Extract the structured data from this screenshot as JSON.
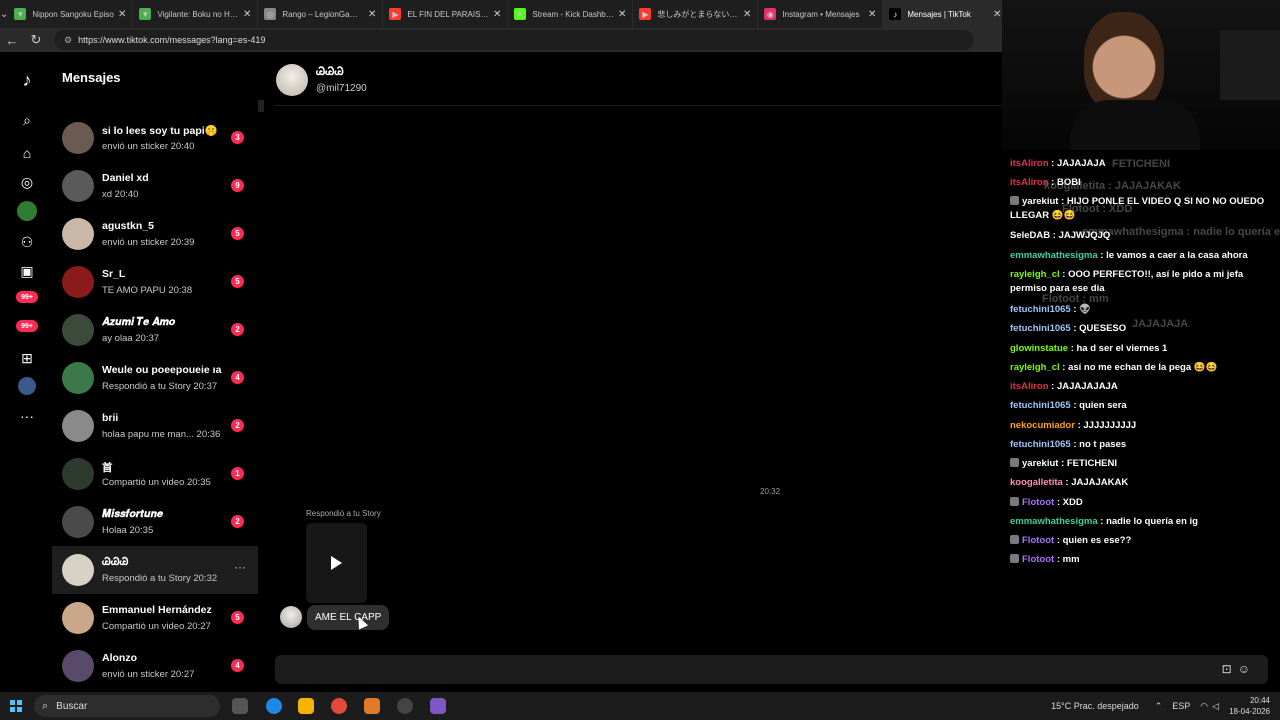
{
  "browser": {
    "tabs": [
      {
        "title": "Nippon Sangoku Episo",
        "color": "#4caf50",
        "glyph": "▼"
      },
      {
        "title": "Vigilante: Boku no Hero",
        "color": "#4caf50",
        "glyph": "▼"
      },
      {
        "title": "Rango – LegionGamesC",
        "color": "#888888",
        "glyph": "◎"
      },
      {
        "title": "EL FIN DEL PARAISO - r",
        "color": "#ff3b30",
        "glyph": "▶"
      },
      {
        "title": "Stream - Kick Dashboar",
        "color": "#53fc18",
        "glyph": "K"
      },
      {
        "title": "悲しみがとまらない | CA",
        "color": "#ff3b30",
        "glyph": "▶"
      },
      {
        "title": "Instagram • Mensajes",
        "color": "#e1306c",
        "glyph": "◉"
      },
      {
        "title": "Mensajes | TikTok",
        "color": "#000000",
        "glyph": "♪"
      }
    ],
    "url": "https://www.tiktok.com/messages?lang=es-419"
  },
  "sidebar": {
    "title": "Mensajes",
    "conversations": [
      {
        "name": "si lo lees soy tu papi🤫",
        "preview": "envió un sticker 20:40",
        "badge": "3",
        "avatar": "#6b5a52"
      },
      {
        "name": "Daniel xd",
        "preview": "xd 20:40",
        "badge": "9",
        "avatar": "#5a5a5a"
      },
      {
        "name": "agustkn_5",
        "preview": "envió un sticker 20:39",
        "badge": "5",
        "avatar": "#c9b8a8"
      },
      {
        "name": "Sr_L",
        "preview": "TE AMO PAPU 20:38",
        "badge": "5",
        "avatar": "#8b1a1a"
      },
      {
        "name": "𝑨𝒛𝒖𝒎𝒊 𝑻𝒆 𝑨𝒎𝒐",
        "preview": "ay olaa 20:37",
        "badge": "2",
        "avatar": "#3b4a3a"
      },
      {
        "name": "Weule ou poeepoueie ıa",
        "preview": "Respondió a tu Story 20:37",
        "badge": "4",
        "avatar": "#3a7a4a"
      },
      {
        "name": "brii",
        "preview": "holaa papu me man... 20:36",
        "badge": "2",
        "avatar": "#8a8a8a"
      },
      {
        "name": "首",
        "preview": "Compartió un video 20:35",
        "badge": "1",
        "avatar": "#2f3a2f"
      },
      {
        "name": "𝑴𝒊𝒔𝒔𝒇𝒐𝒓𝒕𝒖𝒏𝒆",
        "preview": "Holaa 20:35",
        "badge": "2",
        "avatar": "#4a4a4a"
      },
      {
        "name": "ᏊᏊᏊ",
        "preview": "Respondió a tu Story 20:32",
        "badge": "",
        "avatar": "#d8d2c6",
        "selected": true
      },
      {
        "name": "Emmanuel Hernández",
        "preview": "Compartió un video 20:27",
        "badge": "5",
        "avatar": "#c8a888"
      },
      {
        "name": "Alonzo",
        "preview": "envió un sticker 20:27",
        "badge": "4",
        "avatar": "#5a4a6a"
      }
    ]
  },
  "rail": {
    "badges": [
      "99+",
      "99+"
    ]
  },
  "chat": {
    "name": "ᏊᏊᏊ",
    "handle": "@mil71290",
    "timestamp": "20:32",
    "story_label": "Respondió a tu Story",
    "message": "AME EL CAPP"
  },
  "stream_chat": {
    "ghosts": [
      {
        "text": "FETICHENI"
      },
      {
        "text": "koogalletita : JAJAJAKAK"
      },
      {
        "text": "Flotoot : XDD"
      },
      {
        "text": "emmawhathesigma : nadie lo quería en"
      },
      {
        "text": "Flotoot : mm"
      },
      {
        "text": "JAJAJAJA"
      }
    ],
    "lines": [
      {
        "user": "itsAliron",
        "color": "#e0314b",
        "text": " : JAJAJAJA",
        "badge": false
      },
      {
        "user": "itsAliron",
        "color": "#e0314b",
        "text": " : BOBI",
        "badge": false
      },
      {
        "user": "yarekiut",
        "color": "#ffffff",
        "text": " : HIJO PONLE EL VIDEO Q SI NO NO OUEDO LLEGAR 😆😆",
        "badge": true
      },
      {
        "user": "SeleDAB",
        "color": "#ffffff",
        "text": " : JAJWJQJQ",
        "badge": false
      },
      {
        "user": "emmawhathesigma",
        "color": "#3fd09b",
        "text": " : le vamos a caer a la casa ahora",
        "badge": false
      },
      {
        "user": "rayleigh_cl",
        "color": "#7cfc00",
        "text": " : OOO PERFECTO!!, así le pido a mi jefa permiso para ese dia",
        "badge": false
      },
      {
        "user": "fetuchini1065",
        "color": "#9fc5f8",
        "text": " : 👽",
        "badge": false
      },
      {
        "user": "fetuchini1065",
        "color": "#9fc5f8",
        "text": " : QUESESO",
        "badge": false
      },
      {
        "user": "glowinstatue",
        "color": "#7cfc00",
        "text": " : ha d ser el viernes 1",
        "badge": false
      },
      {
        "user": "rayleigh_cl",
        "color": "#7cfc00",
        "text": " : así no me echan de la pega 😆😆",
        "badge": false
      },
      {
        "user": "itsAliron",
        "color": "#e0314b",
        "text": " : JAJAJAJAJA",
        "badge": false
      },
      {
        "user": "fetuchini1065",
        "color": "#9fc5f8",
        "text": " : quien sera",
        "badge": false
      },
      {
        "user": "nekocumiador",
        "color": "#ff9f1a",
        "text": " : JJJJJJJJJJ",
        "badge": false
      },
      {
        "user": "fetuchini1065",
        "color": "#9fc5f8",
        "text": " : no t pases",
        "badge": false
      },
      {
        "user": "yarekiut",
        "color": "#ffffff",
        "text": " : FETICHENI",
        "badge": true
      },
      {
        "user": "koogalletita",
        "color": "#ff8fb1",
        "text": " : JAJAJAKAK",
        "badge": false
      },
      {
        "user": "Flotoot",
        "color": "#a970ff",
        "text": " : XDD",
        "badge": true
      },
      {
        "user": "emmawhathesigma",
        "color": "#3fd09b",
        "text": " : nadie lo quería en ig",
        "badge": false
      },
      {
        "user": "Flotoot",
        "color": "#a970ff",
        "text": " : quien es ese??",
        "badge": true
      },
      {
        "user": "Flotoot",
        "color": "#a970ff",
        "text": " : mm",
        "badge": true
      }
    ]
  },
  "taskbar": {
    "search_label": "Buscar",
    "weather": "15°C  Prac. despejado",
    "lang": "ESP",
    "time": "20:44",
    "date": "18-04-2026"
  }
}
